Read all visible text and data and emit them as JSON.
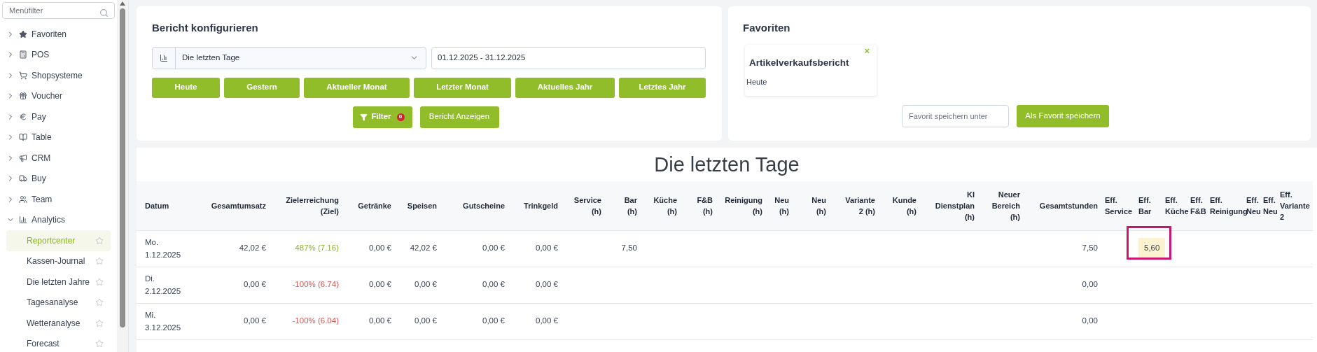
{
  "sidebar": {
    "search": {
      "placeholder": "Menüfilter"
    },
    "items": [
      {
        "label": "Favoriten",
        "expanded": false
      },
      {
        "label": "POS",
        "expanded": false
      },
      {
        "label": "Shopsysteme",
        "expanded": false
      },
      {
        "label": "Voucher",
        "expanded": false
      },
      {
        "label": "Pay",
        "expanded": false
      },
      {
        "label": "Table",
        "expanded": false
      },
      {
        "label": "CRM",
        "expanded": false
      },
      {
        "label": "Buy",
        "expanded": false
      },
      {
        "label": "Team",
        "expanded": false
      },
      {
        "label": "Analytics",
        "expanded": true,
        "children": [
          {
            "label": "Reportcenter",
            "selected": true
          },
          {
            "label": "Kassen-Journal",
            "selected": false
          },
          {
            "label": "Die letzten Jahre",
            "selected": false
          },
          {
            "label": "Tagesanalyse",
            "selected": false
          },
          {
            "label": "Wetteranalyse",
            "selected": false
          },
          {
            "label": "Forecast",
            "selected": false
          }
        ]
      }
    ]
  },
  "config": {
    "title": "Bericht konfigurieren",
    "report_select": "Die letzten Tage",
    "date_range": "01.12.2025 - 31.12.2025",
    "quick_buttons": [
      "Heute",
      "Gestern",
      "Aktueller Monat",
      "Letzter Monat",
      "Aktuelles Jahr",
      "Letztes Jahr"
    ],
    "filter_button": "Filter",
    "filter_count": "0",
    "show_button": "Bericht Anzeigen"
  },
  "favorites": {
    "title": "Favoriten",
    "items": [
      {
        "close": "×",
        "name": "Artikelverkaufsbericht",
        "period": "Heute"
      }
    ],
    "name_field": {
      "placeholder": "Favorit speichern unter"
    },
    "save_button": "Als Favorit speichern"
  },
  "report": {
    "title": "Die letzten Tage",
    "columns": [
      "Datum",
      "Gesamtumsatz",
      "Zielerreichung\n(Ziel)",
      "Getränke",
      "Speisen",
      "Gutscheine",
      "Trinkgeld",
      "Service\n(h)",
      "Bar\n(h)",
      "Küche\n(h)",
      "F&B\n(h)",
      "Reinigung\n(h)",
      "Neu\n(h)",
      "Neu\n(h)",
      "Variante\n2 (h)",
      "Kunde\n(h)",
      "KI\nDienstplan\n(h)",
      "Neuer\nBereich\n(h)",
      "Gesamtstunden",
      "Eff.\nService",
      "Eff.\nBar",
      "Eff.\nKüche",
      "Eff.\nF&B",
      "Eff.\nReinigung",
      "Eff.\nNeu",
      "Eff.\nNeu",
      "Eff.\nVariante\n2"
    ],
    "rows": [
      {
        "goal_met": true,
        "cells": [
          "Mo.\n1.12.2025",
          "42,02 €",
          "487% (7.16)",
          "0,00 €",
          "42,02 €",
          "0,00 €",
          "0,00 €",
          "",
          "7,50",
          "",
          "",
          "",
          "",
          "",
          "",
          "",
          "",
          "",
          "7,50",
          "",
          {
            "text": "5,60",
            "highlighted": true,
            "annotated": true
          },
          "",
          "",
          "",
          "",
          "",
          ""
        ]
      },
      {
        "goal_met": false,
        "cells": [
          "Di.\n2.12.2025",
          "0,00 €",
          "-100% (6.74)",
          "0,00 €",
          "0,00 €",
          "0,00 €",
          "0,00 €",
          "",
          "",
          "",
          "",
          "",
          "",
          "",
          "",
          "",
          "",
          "",
          "0,00",
          "",
          "",
          "",
          "",
          "",
          "",
          "",
          ""
        ]
      },
      {
        "goal_met": false,
        "cells": [
          "Mi.\n3.12.2025",
          "0,00 €",
          "-100% (6.04)",
          "0,00 €",
          "0,00 €",
          "0,00 €",
          "0,00 €",
          "",
          "",
          "",
          "",
          "",
          "",
          "",
          "",
          "",
          "",
          "",
          "0,00",
          "",
          "",
          "",
          "",
          "",
          "",
          "",
          ""
        ]
      }
    ]
  }
}
